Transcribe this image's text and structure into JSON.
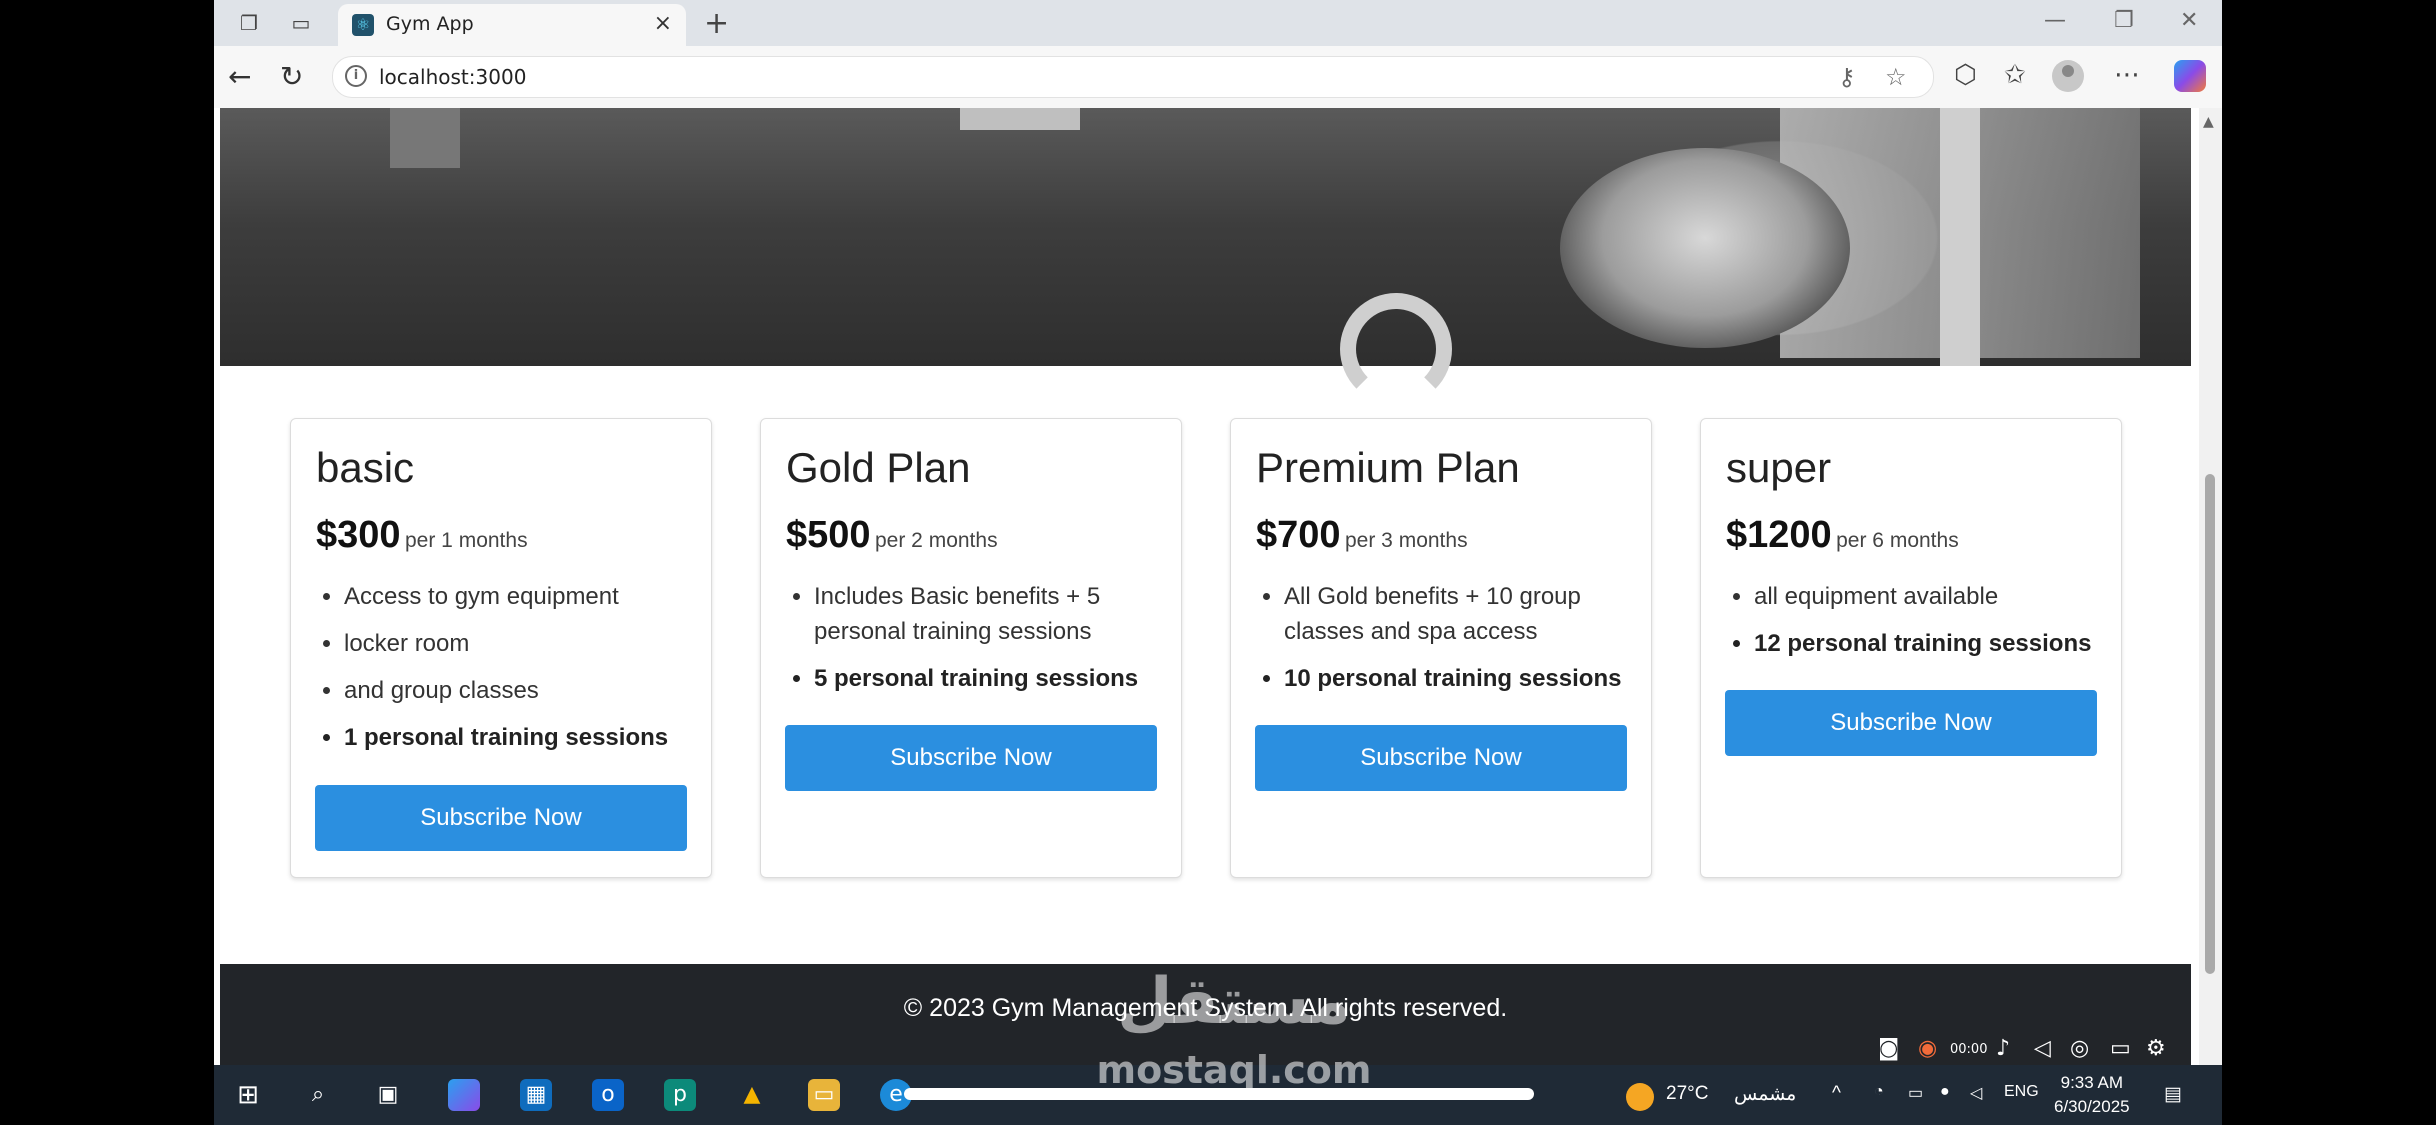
{
  "browser": {
    "tab_title": "Gym App",
    "url": "localhost:3000"
  },
  "plans": [
    {
      "name": "basic",
      "price": "$300",
      "period": "per 1 months",
      "features": [
        "Access to gym equipment",
        "locker room",
        "and group classes"
      ],
      "sessions": "1 personal training sessions",
      "button": "Subscribe Now"
    },
    {
      "name": "Gold Plan",
      "price": "$500",
      "period": "per 2 months",
      "features": [
        "Includes Basic benefits + 5 personal training sessions"
      ],
      "sessions": "5 personal training sessions",
      "button": "Subscribe Now"
    },
    {
      "name": "Premium Plan",
      "price": "$700",
      "period": "per 3 months",
      "features": [
        "All Gold benefits + 10 group classes and spa access"
      ],
      "sessions": "10 personal training sessions",
      "button": "Subscribe Now"
    },
    {
      "name": "super",
      "price": "$1200",
      "period": "per 6 months",
      "features": [
        "all equipment available"
      ],
      "sessions": "12 personal training sessions",
      "button": "Subscribe Now"
    }
  ],
  "footer": {
    "text": "© 2023 Gym Management System. All rights reserved."
  },
  "taskbar": {
    "weather_temp": "27°C",
    "weather_desc": "مشمس",
    "language": "ENG",
    "time": "9:33 AM",
    "date": "6/30/2025",
    "recorder_time": "00:00"
  },
  "overlay": {
    "watermark_ar": "مستقل",
    "watermark_en": "mostaql.com"
  },
  "colors": {
    "button": "#2b8fe0",
    "footer": "#222529",
    "taskbar": "#1f2a36"
  }
}
